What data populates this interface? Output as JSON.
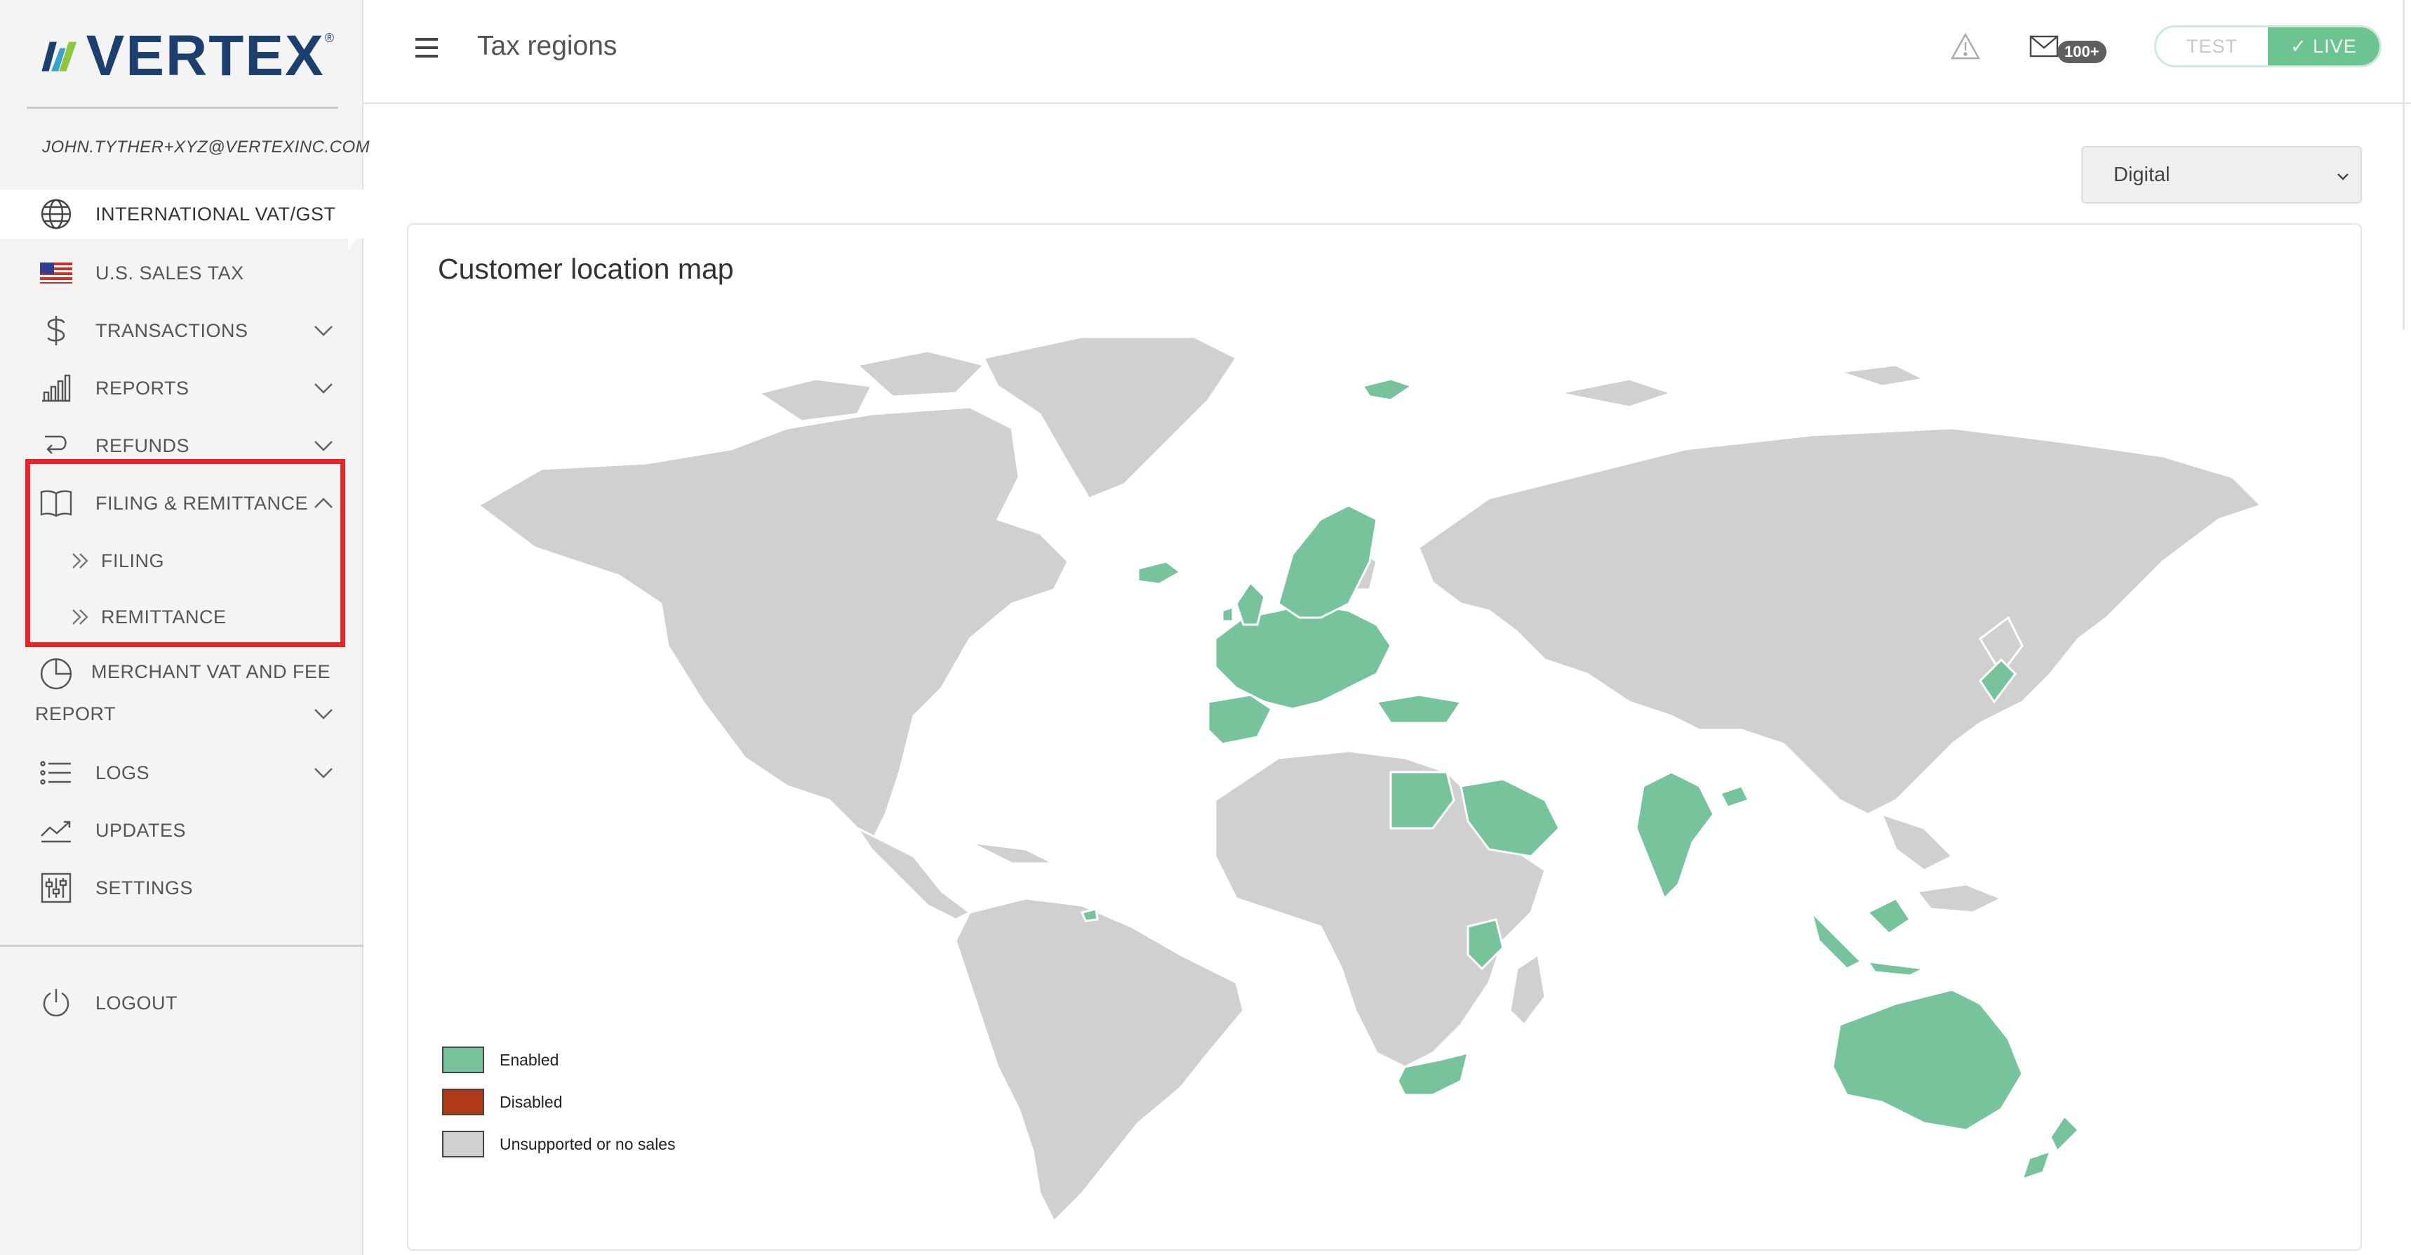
{
  "brand": {
    "name": "VERTEX",
    "registered_mark": "®"
  },
  "user": {
    "email": "JOHN.TYTHER+XYZ@VERTEXINC.COM"
  },
  "sidebar": {
    "items": [
      {
        "label": "INTERNATIONAL VAT/GST",
        "icon": "globe-icon",
        "active": true
      },
      {
        "label": "U.S. SALES TAX",
        "icon": "us-flag-icon"
      },
      {
        "label": "TRANSACTIONS",
        "icon": "dollar-icon",
        "expandable": true
      },
      {
        "label": "REPORTS",
        "icon": "bar-chart-icon",
        "expandable": true
      },
      {
        "label": "REFUNDS",
        "icon": "refund-arrow-icon",
        "expandable": true
      },
      {
        "label": "FILING & REMITTANCE",
        "icon": "book-icon",
        "expanded": true
      }
    ],
    "submenu": [
      {
        "label": "FILING"
      },
      {
        "label": "REMITTANCE"
      }
    ],
    "merchant": {
      "line1": "MERCHANT VAT AND FEE",
      "line2": "REPORT"
    },
    "logs": {
      "label": "LOGS"
    },
    "updates": {
      "label": "UPDATES"
    },
    "settings": {
      "label": "SETTINGS"
    },
    "logout": {
      "label": "LOGOUT"
    },
    "highlight_color": "#e8262a"
  },
  "header": {
    "title": "Tax regions",
    "mail_badge": "100+",
    "env_test": "TEST",
    "env_live": "✓ LIVE",
    "env_selected": "LIVE"
  },
  "filter": {
    "selected": "Digital"
  },
  "map_card": {
    "title": "Customer location map",
    "legend": [
      {
        "label": "Enabled",
        "color": "#77c39b"
      },
      {
        "label": "Disabled",
        "color": "#b03a17"
      },
      {
        "label": "Unsupported or no sales",
        "color": "#d0d0d0"
      }
    ]
  },
  "colors": {
    "accent_green": "#6cc590",
    "land_gray": "#d0d0d0",
    "enabled_green": "#77c39b"
  }
}
